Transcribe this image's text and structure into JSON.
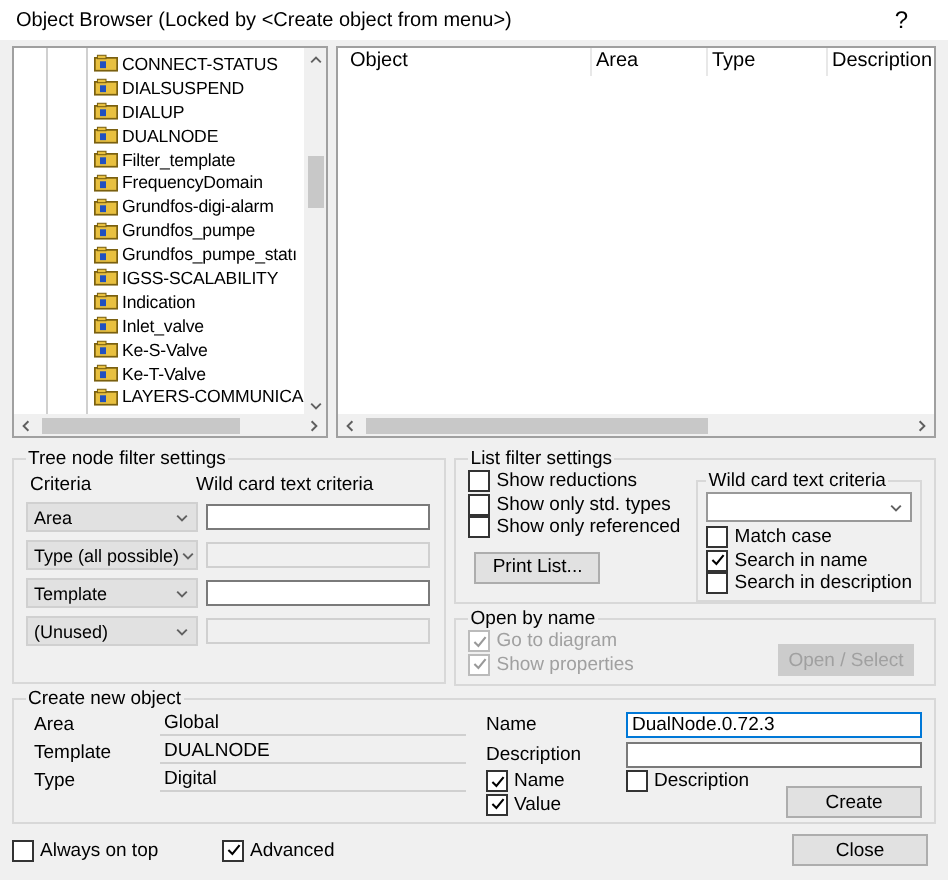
{
  "window": {
    "title": "Object Browser (Locked by <Create object from menu>)",
    "help": "?"
  },
  "tree": {
    "items": [
      {
        "label": "CONNECT-STATUS"
      },
      {
        "label": "DIALSUSPEND"
      },
      {
        "label": "DIALUP"
      },
      {
        "label": "DUALNODE"
      },
      {
        "label": "Filter_template"
      },
      {
        "label": "FrequencyDomain"
      },
      {
        "label": "Grundfos-digi-alarm"
      },
      {
        "label": "Grundfos_pumpe"
      },
      {
        "label": "Grundfos_pumpe_statı"
      },
      {
        "label": "IGSS-SCALABILITY"
      },
      {
        "label": "Indication"
      },
      {
        "label": "Inlet_valve"
      },
      {
        "label": "Ke-S-Valve"
      },
      {
        "label": "Ke-T-Valve"
      },
      {
        "label": "LAYERS-COMMUNICA"
      }
    ]
  },
  "table": {
    "columns": [
      "Object",
      "Area",
      "Type",
      "Description"
    ]
  },
  "tree_filter": {
    "title": "Tree node filter settings",
    "criteria_label": "Criteria",
    "wildcard_label": "Wild card text criteria",
    "rows": [
      {
        "criterion": "Area",
        "disabled": false
      },
      {
        "criterion": "Type (all possible)",
        "disabled": true
      },
      {
        "criterion": "Template",
        "disabled": false
      },
      {
        "criterion": "(Unused)",
        "disabled": true
      }
    ]
  },
  "list_filter": {
    "title": "List filter settings",
    "options": [
      {
        "label": "Show reductions",
        "checked": false
      },
      {
        "label": "Show only std. types",
        "checked": false
      },
      {
        "label": "Show only referenced",
        "checked": false
      }
    ],
    "print_button": "Print List...",
    "wildcard": {
      "title": "Wild card text criteria",
      "options": [
        {
          "label": "Match case",
          "checked": false
        },
        {
          "label": "Search in name",
          "checked": true
        },
        {
          "label": "Search in description",
          "checked": false
        }
      ]
    }
  },
  "open_by_name": {
    "title": "Open by name",
    "options": [
      {
        "label": "Go to diagram",
        "checked": true,
        "disabled": true
      },
      {
        "label": "Show properties",
        "checked": true,
        "disabled": true
      }
    ],
    "button": {
      "label": "Open / Select",
      "disabled": true
    }
  },
  "create": {
    "title": "Create new object",
    "fields": [
      {
        "label": "Area",
        "value": "Global"
      },
      {
        "label": "Template",
        "value": "DUALNODE"
      },
      {
        "label": "Type",
        "value": "Digital"
      }
    ],
    "name_label": "Name",
    "name_value": "DualNode.0.72.3",
    "description_label": "Description",
    "options": [
      {
        "label": "Name",
        "checked": true
      },
      {
        "label": "Value",
        "checked": true
      },
      {
        "label": "Description",
        "checked": false
      }
    ],
    "button": "Create"
  },
  "footer": {
    "options": [
      {
        "label": "Always on top",
        "checked": false
      },
      {
        "label": "Advanced",
        "checked": true
      }
    ],
    "close": "Close"
  }
}
